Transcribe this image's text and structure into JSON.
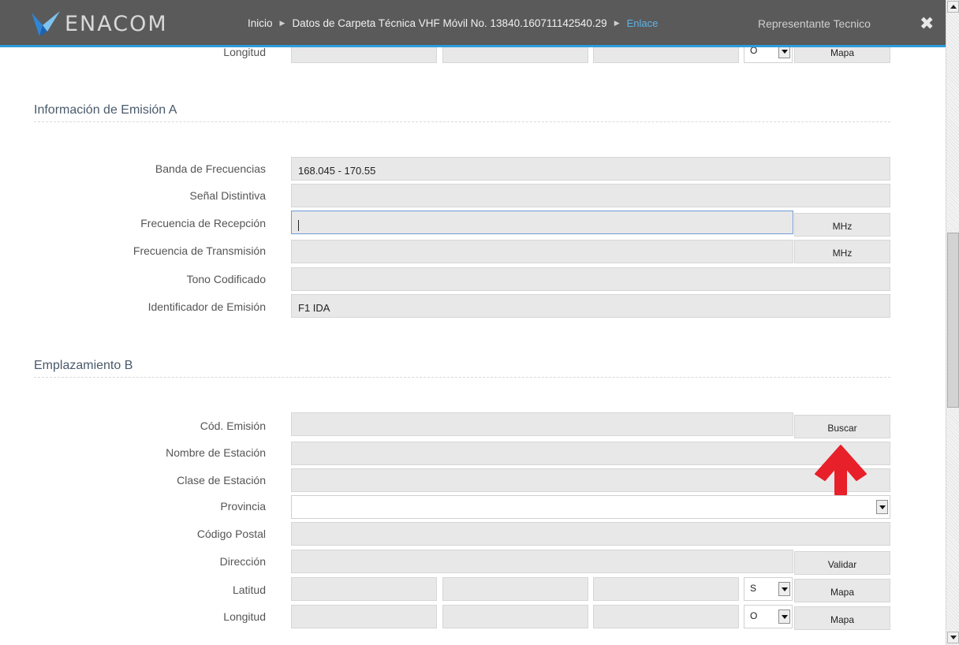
{
  "header": {
    "logo_text": "ENACOM",
    "breadcrumbs": [
      "Inicio",
      "Datos de Carpeta Técnica VHF Móvil No. 13840.160711142540.29"
    ],
    "breadcrumb_active": "Enlace",
    "user_label": "Representante Tecnico",
    "close_glyph": "✖",
    "accent_color": "#2d9cdb"
  },
  "top_partial": {
    "longitud_label": "Longitud",
    "dir_value": "O",
    "map_button": "Mapa"
  },
  "section_a": {
    "title": "Información de Emisión A",
    "rows": [
      {
        "label": "Banda de Frecuencias",
        "value": "168.045 - 170.55"
      },
      {
        "label": "Señal Distintiva",
        "value": ""
      },
      {
        "label": "Frecuencia de Recepción",
        "value": "",
        "unit": "MHz"
      },
      {
        "label": "Frecuencia de Transmisión",
        "value": "",
        "unit": "MHz"
      },
      {
        "label": "Tono Codificado",
        "value": ""
      },
      {
        "label": "Identificador de Emisión",
        "value": "F1 IDA"
      }
    ]
  },
  "section_b": {
    "title": "Emplazamiento B",
    "rows": [
      {
        "label": "Cód. Emisión",
        "value": "",
        "button": "Buscar"
      },
      {
        "label": "Nombre de Estación",
        "value": ""
      },
      {
        "label": "Clase de Estación",
        "value": ""
      },
      {
        "label": "Provincia",
        "value": ""
      },
      {
        "label": "Código Postal",
        "value": ""
      },
      {
        "label": "Dirección",
        "value": "",
        "button": "Validar"
      },
      {
        "label": "Latitud",
        "dir": "S",
        "button": "Mapa"
      },
      {
        "label": "Longitud",
        "dir": "O",
        "button": "Mapa"
      }
    ]
  },
  "annotation": {
    "icon": "red-up-arrow-icon",
    "color": "#e8202a"
  }
}
